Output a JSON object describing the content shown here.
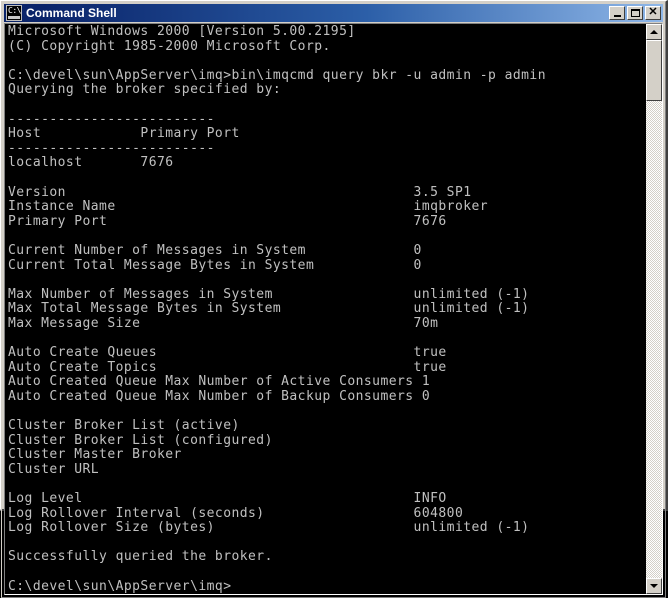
{
  "window": {
    "title": "Command Shell",
    "icon": "command-prompt-icon",
    "buttons": {
      "minimize": "_",
      "maximize": "□",
      "close": "✕"
    },
    "colors": {
      "title_active_left": "#0a246a",
      "title_active_right": "#8fb7e8",
      "face": "#d4d0c8",
      "console_bg": "#000000",
      "console_fg": "#c0c0c0"
    }
  },
  "scrollbar": {
    "up_arrow": "▲",
    "down_arrow": "▼"
  },
  "console": {
    "prompt": "C:\\devel\\sun\\AppServer\\imq>",
    "command": "bin\\imqcmd query bkr -u admin -p admin",
    "lines": [
      "Microsoft Windows 2000 [Version 5.00.2195]",
      "(C) Copyright 1985-2000 Microsoft Corp.",
      "",
      "C:\\devel\\sun\\AppServer\\imq>bin\\imqcmd query bkr -u admin -p admin",
      "Querying the broker specified by:",
      "",
      "-------------------------",
      "Host            Primary Port",
      "-------------------------",
      "localhost       7676",
      "",
      "Version                                          3.5 SP1",
      "Instance Name                                    imqbroker",
      "Primary Port                                     7676",
      "",
      "Current Number of Messages in System             0",
      "Current Total Message Bytes in System            0",
      "",
      "Max Number of Messages in System                 unlimited (-1)",
      "Max Total Message Bytes in System                unlimited (-1)",
      "Max Message Size                                 70m",
      "",
      "Auto Create Queues                               true",
      "Auto Create Topics                               true",
      "Auto Created Queue Max Number of Active Consumers 1",
      "Auto Created Queue Max Number of Backup Consumers 0",
      "",
      "Cluster Broker List (active)",
      "Cluster Broker List (configured)",
      "Cluster Master Broker",
      "Cluster URL",
      "",
      "Log Level                                        INFO",
      "Log Rollover Interval (seconds)                  604800",
      "Log Rollover Size (bytes)                        unlimited (-1)",
      "",
      "Successfully queried the broker.",
      "",
      "C:\\devel\\sun\\AppServer\\imq>"
    ],
    "broker_table": {
      "headers": [
        "Host",
        "Primary Port"
      ],
      "rows": [
        [
          "localhost",
          "7676"
        ]
      ]
    },
    "broker_properties": [
      {
        "name": "Version",
        "value": "3.5 SP1"
      },
      {
        "name": "Instance Name",
        "value": "imqbroker"
      },
      {
        "name": "Primary Port",
        "value": "7676"
      },
      {
        "name": "Current Number of Messages in System",
        "value": "0"
      },
      {
        "name": "Current Total Message Bytes in System",
        "value": "0"
      },
      {
        "name": "Max Number of Messages in System",
        "value": "unlimited (-1)"
      },
      {
        "name": "Max Total Message Bytes in System",
        "value": "unlimited (-1)"
      },
      {
        "name": "Max Message Size",
        "value": "70m"
      },
      {
        "name": "Auto Create Queues",
        "value": "true"
      },
      {
        "name": "Auto Create Topics",
        "value": "true"
      },
      {
        "name": "Auto Created Queue Max Number of Active Consumers",
        "value": "1"
      },
      {
        "name": "Auto Created Queue Max Number of Backup Consumers",
        "value": "0"
      },
      {
        "name": "Cluster Broker List (active)",
        "value": ""
      },
      {
        "name": "Cluster Broker List (configured)",
        "value": ""
      },
      {
        "name": "Cluster Master Broker",
        "value": ""
      },
      {
        "name": "Cluster URL",
        "value": ""
      },
      {
        "name": "Log Level",
        "value": "INFO"
      },
      {
        "name": "Log Rollover Interval (seconds)",
        "value": "604800"
      },
      {
        "name": "Log Rollover Size (bytes)",
        "value": "unlimited (-1)"
      }
    ],
    "status_message": "Successfully queried the broker."
  }
}
